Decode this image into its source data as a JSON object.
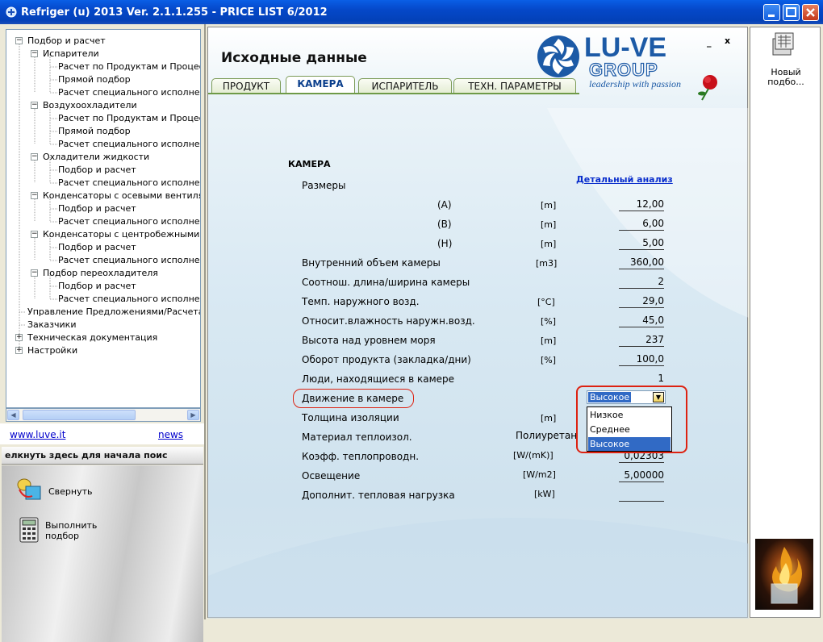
{
  "window": {
    "title": "Refriger (u) 2013 Ver. 2.1.1.255 - PRICE LIST 6/2012",
    "controls": [
      "minimize",
      "maximize",
      "close"
    ]
  },
  "tree": {
    "items": [
      {
        "label": "Подбор и расчет",
        "expander": "−"
      },
      {
        "label": "Испарители",
        "expander": "−"
      },
      {
        "label": "Расчет по Продуктам и Процессам"
      },
      {
        "label": "Прямой подбор"
      },
      {
        "label": "Расчет специального исполнения"
      },
      {
        "label": "Воздухоохладители",
        "expander": "−"
      },
      {
        "label": "Расчет по Продуктам и Процессам"
      },
      {
        "label": "Прямой подбор"
      },
      {
        "label": "Расчет специального исполнения"
      },
      {
        "label": "Охладители жидкости",
        "expander": "−"
      },
      {
        "label": "Подбор и расчет"
      },
      {
        "label": "Расчет специального исполнения"
      },
      {
        "label": "Конденсаторы с осевыми вентилятор",
        "expander": "−"
      },
      {
        "label": "Подбор и расчет"
      },
      {
        "label": "Расчет специального исполнения"
      },
      {
        "label": "Конденсаторы с центробежными вент",
        "expander": "−"
      },
      {
        "label": "Подбор и расчет"
      },
      {
        "label": "Расчет специального исполнения"
      },
      {
        "label": "Подбор переохладителя",
        "expander": "−"
      },
      {
        "label": "Подбор и расчет"
      },
      {
        "label": "Расчет специального исполнения"
      },
      {
        "label": "Управление Предложениями/Расчетами"
      },
      {
        "label": "Заказчики"
      },
      {
        "label": "Техническая документация",
        "expander": "+"
      },
      {
        "label": "Настройки",
        "expander": "+"
      }
    ]
  },
  "links": {
    "site": "www.luve.it",
    "news": "news"
  },
  "search_hint": "елкнуть здесь для начала поис",
  "actions": {
    "collapse": "Свернуть",
    "run_line1": "Выполнить",
    "run_line2": "подбор"
  },
  "main": {
    "title": "Исходные данные",
    "tabs": [
      "ПРОДУКТ",
      "КАМЕРА",
      "ИСПАРИТЕЛЬ",
      "ТЕХН. ПАРАМЕТРЫ"
    ],
    "active_tab": "КАМЕРА",
    "minimize": "_",
    "close": "x",
    "section_title": "КАМЕРА",
    "detail_link": "Детальный анализ"
  },
  "logo": {
    "line1": "LU-VE",
    "line2": "GROUP",
    "tagline": "leadership with passion"
  },
  "fields": {
    "dims_label": "Размеры",
    "a_sub": "(A)",
    "a_unit": "[m]",
    "a_val": "12,00",
    "b_sub": "(B)",
    "b_unit": "[m]",
    "b_val": "6,00",
    "h_sub": "(H)",
    "h_unit": "[m]",
    "h_val": "5,00",
    "volume_label": "Внутренний объем камеры",
    "volume_unit": "[m3]",
    "volume_val": "360,00",
    "ratio_label": "Соотнош. длина/ширина камеры",
    "ratio_val": "2",
    "temp_label": "Темп. наружного возд.",
    "temp_unit": "[°C]",
    "temp_val": "29,0",
    "hum_label": "Относит.влажность наружн.возд.",
    "hum_unit": "[%]",
    "hum_val": "45,0",
    "alt_label": "Высота над уровнем моря",
    "alt_unit": "[m]",
    "alt_val": "237",
    "turn_label": "Оборот продукта (закладка/дни)",
    "turn_unit": "[%]",
    "turn_val": "100,0",
    "people_label": "Люди, находящиеся в камере",
    "people_val": "1",
    "move_label": "Движение в камере",
    "ins_label": "Толщина изоляции",
    "ins_unit": "[m]",
    "mat_label": "Материал теплоизол.",
    "mat_val": "Полиуретан",
    "cond_label": "Коэфф. теплопроводн.",
    "cond_unit": "[W/(mK)]",
    "cond_val": "0,02303",
    "light_label": "Освещение",
    "light_unit": "[W/m2]",
    "light_val": "5,00000",
    "extra_label": "Дополнит. тепловая нагрузка",
    "extra_unit": "[kW]",
    "extra_val": ""
  },
  "combo": {
    "selected": "Высокое",
    "options": [
      "Низкое",
      "Среднее",
      "Высокое"
    ]
  },
  "right": {
    "new_line1": "Новый",
    "new_line2": "подбо..."
  },
  "colors": {
    "titlebar": "#0548c9",
    "tab_border": "#7a9a55",
    "highlight": "#d21f1f",
    "selection": "#316ac5",
    "link": "#0a2ecc"
  }
}
